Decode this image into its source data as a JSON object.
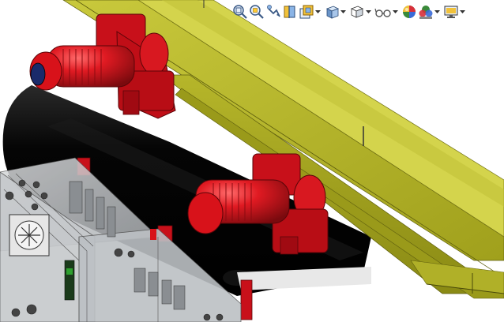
{
  "window": {
    "type": "cad-3d-viewport"
  },
  "heads_up_toolbar": {
    "items": [
      {
        "id": "zoom-to-fit",
        "icon": "zoom-to-fit-icon",
        "has_dropdown": false
      },
      {
        "id": "zoom-to-area",
        "icon": "zoom-to-area-icon",
        "has_dropdown": false
      },
      {
        "id": "previous-view",
        "icon": "previous-view-icon",
        "has_dropdown": false
      },
      {
        "id": "section-view",
        "icon": "section-view-icon",
        "has_dropdown": false
      },
      {
        "id": "dynamic-annotation-views",
        "icon": "dynamic-annotation-views-icon",
        "has_dropdown": true
      },
      {
        "id": "view-orientation",
        "icon": "view-orientation-cube-icon",
        "has_dropdown": true
      },
      {
        "id": "display-style",
        "icon": "display-style-icon",
        "has_dropdown": true
      },
      {
        "id": "hide-show-items",
        "icon": "hide-show-items-glasses-icon",
        "has_dropdown": true
      },
      {
        "id": "edit-appearance",
        "icon": "edit-appearance-sphere-icon",
        "has_dropdown": false
      },
      {
        "id": "apply-scene",
        "icon": "apply-scene-icon",
        "has_dropdown": true
      },
      {
        "id": "view-settings",
        "icon": "view-settings-monitor-icon",
        "has_dropdown": true
      }
    ]
  },
  "colors": {
    "background": "#ffffff",
    "beam_yellow": "#a8a81e",
    "beam_yellow_light": "#c8c83a",
    "beam_yellow_dark": "#6e6e12",
    "hoist_red": "#d8121a",
    "hoist_red_dark": "#8a0a10",
    "pipe_black": "#0a0a0a",
    "cabinet_grey": "#b8bcc0"
  }
}
